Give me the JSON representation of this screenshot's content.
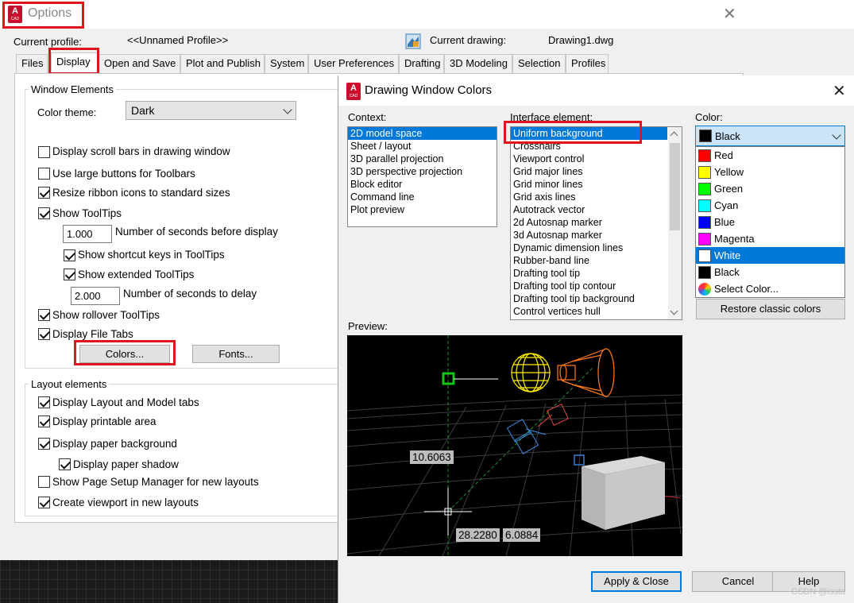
{
  "options_window": {
    "title": "Options",
    "current_profile_label": "Current profile:",
    "current_profile_value": "<<Unnamed Profile>>",
    "current_drawing_label": "Current drawing:",
    "current_drawing_value": "Drawing1.dwg",
    "tabs": [
      {
        "label": "Files"
      },
      {
        "label": "Display",
        "active": true
      },
      {
        "label": "Open and Save"
      },
      {
        "label": "Plot and Publish"
      },
      {
        "label": "System"
      },
      {
        "label": "User Preferences"
      },
      {
        "label": "Drafting"
      },
      {
        "label": "3D Modeling"
      },
      {
        "label": "Selection"
      },
      {
        "label": "Profiles"
      }
    ],
    "window_elements": {
      "title": "Window Elements",
      "color_theme_label": "Color theme:",
      "color_theme_value": "Dark",
      "scroll_bars": {
        "label": "Display scroll bars in drawing window",
        "checked": false
      },
      "large_buttons": {
        "label": "Use large buttons for Toolbars",
        "checked": false
      },
      "resize_ribbon": {
        "label": "Resize ribbon icons to standard sizes",
        "checked": true
      },
      "show_tooltips": {
        "label": "Show ToolTips",
        "checked": true
      },
      "seconds_before_value": "1.000",
      "seconds_before_label": "Number of seconds before display",
      "shortcut_keys": {
        "label": "Show shortcut keys in ToolTips",
        "checked": true
      },
      "extended_tooltips": {
        "label": "Show extended ToolTips",
        "checked": true
      },
      "seconds_delay_value": "2.000",
      "seconds_delay_label": "Number of seconds to delay",
      "rollover_tooltips": {
        "label": "Show rollover ToolTips",
        "checked": true
      },
      "file_tabs": {
        "label": "Display File Tabs",
        "checked": true
      },
      "colors_button": "Colors...",
      "fonts_button": "Fonts..."
    },
    "layout_elements": {
      "title": "Layout elements",
      "layout_model_tabs": {
        "label": "Display Layout and Model tabs",
        "checked": true
      },
      "printable_area": {
        "label": "Display printable area",
        "checked": true
      },
      "paper_background": {
        "label": "Display paper background",
        "checked": true
      },
      "paper_shadow": {
        "label": "Display paper shadow",
        "checked": true
      },
      "page_setup_manager": {
        "label": "Show Page Setup Manager for new layouts",
        "checked": false
      },
      "create_viewport": {
        "label": "Create viewport in new layouts",
        "checked": true
      }
    }
  },
  "dwc_dialog": {
    "title": "Drawing Window Colors",
    "context_label": "Context:",
    "context_items": [
      "2D model space",
      "Sheet / layout",
      "3D parallel projection",
      "3D perspective projection",
      "Block editor",
      "Command line",
      "Plot preview"
    ],
    "context_selected_index": 0,
    "interface_label": "Interface element:",
    "interface_items": [
      "Uniform background",
      "Crosshairs",
      "Viewport control",
      "Grid major lines",
      "Grid minor lines",
      "Grid axis lines",
      "Autotrack vector",
      "2d Autosnap marker",
      "3d Autosnap marker",
      "Dynamic dimension lines",
      "Rubber-band line",
      "Drafting tool tip",
      "Drafting tool tip contour",
      "Drafting tool tip background",
      "Control vertices hull"
    ],
    "interface_selected_index": 0,
    "color_label": "Color:",
    "color_value": "Black",
    "color_value_swatch": "#000000",
    "color_options": [
      {
        "name": "Red",
        "swatch": "#ff0000"
      },
      {
        "name": "Yellow",
        "swatch": "#ffff00"
      },
      {
        "name": "Green",
        "swatch": "#00ff00"
      },
      {
        "name": "Cyan",
        "swatch": "#00ffff"
      },
      {
        "name": "Blue",
        "swatch": "#0000ff"
      },
      {
        "name": "Magenta",
        "swatch": "#ff00ff"
      },
      {
        "name": "White",
        "swatch": "#ffffff",
        "selected": true
      },
      {
        "name": "Black",
        "swatch": "#000000"
      },
      {
        "name": "Select Color...",
        "swatch": "color-wheel-icon"
      }
    ],
    "restore_button": "Restore classic colors",
    "preview_label": "Preview:",
    "preview_coords": {
      "a": "10.6063",
      "b": "28.2280",
      "c": "6.0884"
    },
    "apply_button": "Apply & Close",
    "cancel_button": "Cancel",
    "help_button": "Help"
  },
  "watermark": "CSDN @issta"
}
